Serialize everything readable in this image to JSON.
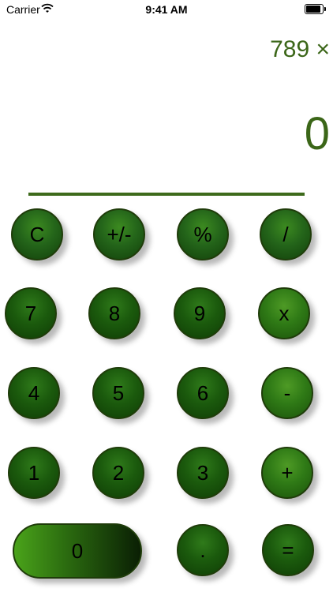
{
  "status_bar": {
    "carrier": "Carrier",
    "time": "9:41 AM"
  },
  "display": {
    "expression": "789 ×",
    "result": "0"
  },
  "colors": {
    "accent": "#3b6618",
    "key_dark": "#0f3d05",
    "key_mid": "#1b5a0d"
  },
  "keys": {
    "clear": "C",
    "plus_minus": "+/-",
    "percent": "%",
    "divide": "/",
    "seven": "7",
    "eight": "8",
    "nine": "9",
    "multiply": "x",
    "four": "4",
    "five": "5",
    "six": "6",
    "minus": "-",
    "one": "1",
    "two": "2",
    "three": "3",
    "plus": "+",
    "zero": "0",
    "decimal": ".",
    "equals": "="
  }
}
